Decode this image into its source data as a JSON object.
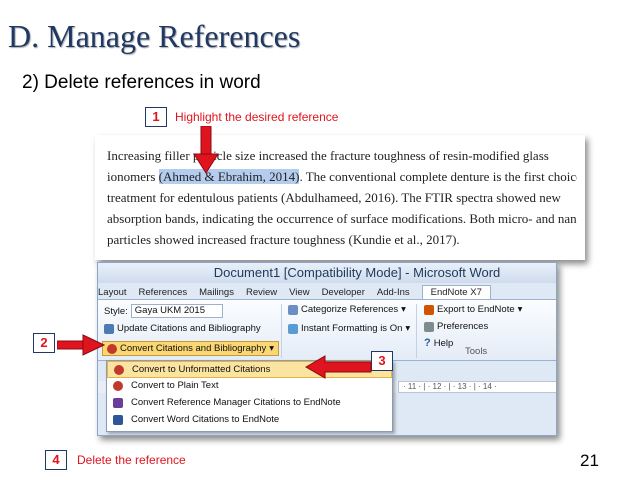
{
  "slide": {
    "title": "D. Manage References",
    "subtitle": "2) Delete references in word",
    "page_number": "21"
  },
  "steps": [
    {
      "number": "1",
      "text": "Highlight the desired reference"
    },
    {
      "number": "2",
      "text": ""
    },
    {
      "number": "3",
      "text": ""
    },
    {
      "number": "4",
      "text": "Delete the reference"
    }
  ],
  "document": {
    "line1": "Increasing filler particle size increased the fracture toughness of resin-modified glass",
    "line2_before": "ionomers ",
    "line2_highlight": "(Ahmed & Ebrahim, 2014)",
    "line2_after": ". The conventional complete denture is the first choice of",
    "line3": "treatment for edentulous patients (Abdulhameed, 2016). The FTIR spectra showed new",
    "line4": "absorption bands, indicating the occurrence of surface modifications. Both micro- and nanoscale",
    "line5": "particles showed increased fracture toughness (Kundie et al., 2017)."
  },
  "word": {
    "window_title": "Document1 [Compatibility Mode] - Microsoft Word",
    "tabs": [
      "Layout",
      "References",
      "Mailings",
      "Review",
      "View",
      "Developer",
      "Add-Ins",
      "EndNote X7"
    ],
    "active_tab": "EndNote X7",
    "style_label": "Style:",
    "style_value": "Gaya UKM 2015",
    "update_label": "Update Citations and Bibliography",
    "convert_label": "Convert Citations and Bibliography",
    "categorize_label": "Categorize References",
    "instant_label": "Instant Formatting is On",
    "export_label": "Export to EndNote",
    "preferences_label": "Preferences",
    "help_label": "Help",
    "tools_group": "Tools",
    "ruler_text": "· 11 · | · 12 · | · 13 · | · 14 ·",
    "menu_items": [
      "Convert to Unformatted Citations",
      "Convert to Plain Text",
      "Convert Reference Manager Citations to EndNote",
      "Convert Word Citations to EndNote"
    ]
  },
  "colors": {
    "title": "#1f3864",
    "step_text": "#e0141e",
    "arrow": "#e0141e",
    "highlight": "#b4cdee"
  }
}
